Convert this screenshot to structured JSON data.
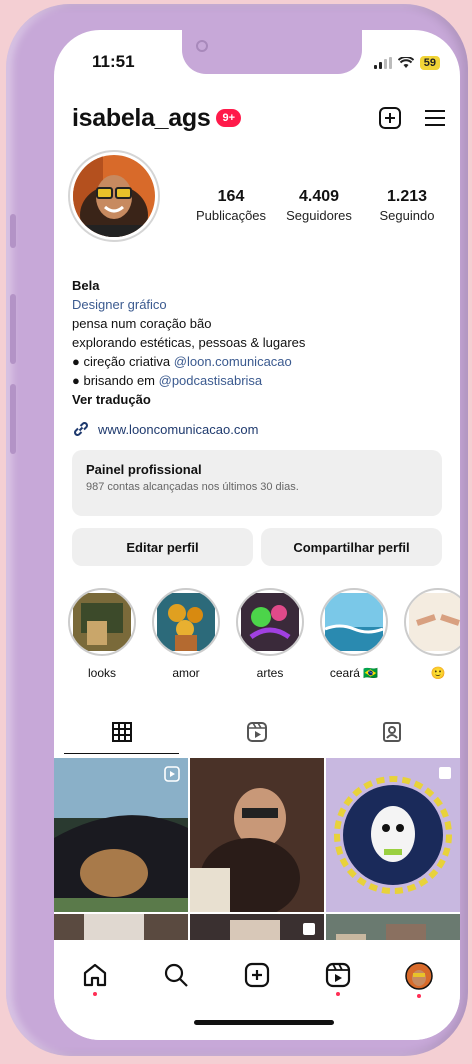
{
  "status": {
    "time": "11:51",
    "battery": "59"
  },
  "header": {
    "username": "isabela_ags",
    "notif_badge": "9+"
  },
  "stats": [
    {
      "value": "164",
      "label": "Publicações"
    },
    {
      "value": "4.409",
      "label": "Seguidores"
    },
    {
      "value": "1.213",
      "label": "Seguindo"
    }
  ],
  "bio": {
    "name": "Bela",
    "category": "Designer gráfico",
    "line1": "pensa num coração bão",
    "line2": "explorando estéticas, pessoas & lugares",
    "line3_prefix": "● cireção criativa ",
    "line3_mention": "@loon.comunicacao",
    "line4_prefix": "● brisando em ",
    "line4_mention": "@podcastisabrisa",
    "translate": "Ver tradução"
  },
  "link": "www.looncomunicacao.com",
  "panel": {
    "title": "Painel profissional",
    "subtitle": "987 contas alcançadas nos últimos 30 dias."
  },
  "buttons": {
    "edit": "Editar perfil",
    "share": "Compartilhar perfil"
  },
  "highlights": [
    {
      "label": "looks"
    },
    {
      "label": "amor"
    },
    {
      "label": "artes"
    },
    {
      "label": "ceará 🇧🇷"
    },
    {
      "label": "🙂"
    }
  ],
  "colors": {
    "phone": "#c7a8d8",
    "badge": "#ff1a4a",
    "link": "#3b5a8f",
    "background": "#f4cfd3"
  },
  "icons": [
    "new-post-icon",
    "menu-icon",
    "link-icon",
    "grid-icon",
    "reels-icon",
    "tagged-icon",
    "home-icon",
    "search-icon",
    "create-icon",
    "reels-nav-icon",
    "profile-avatar-icon"
  ]
}
